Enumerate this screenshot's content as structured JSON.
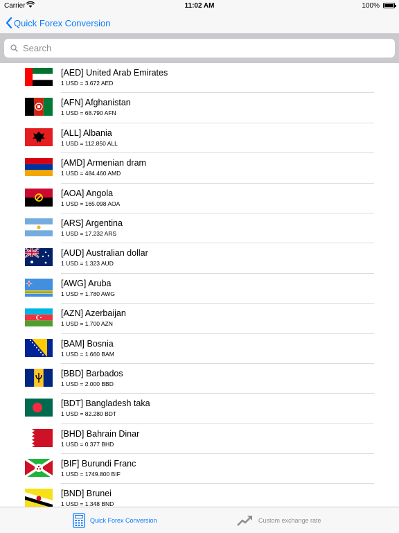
{
  "status_bar": {
    "carrier": "Carrier",
    "time": "11:02 AM",
    "battery": "100%"
  },
  "nav": {
    "back_label": "Quick Forex Conversion"
  },
  "search": {
    "placeholder": "Search"
  },
  "currencies": [
    {
      "title": "[AED] United Arab Emirates",
      "rate": "1 USD = 3.672 AED",
      "flag": "flag-uae"
    },
    {
      "title": "[AFN] Afghanistan",
      "rate": "1 USD = 68.790 AFN",
      "flag": "flag-afghanistan"
    },
    {
      "title": "[ALL] Albania",
      "rate": "1 USD = 112.850 ALL",
      "flag": "flag-albania"
    },
    {
      "title": "[AMD] Armenian dram",
      "rate": "1 USD = 484.460 AMD",
      "flag": "flag-armenia"
    },
    {
      "title": "[AOA] Angola",
      "rate": "1 USD = 165.098 AOA",
      "flag": "flag-angola"
    },
    {
      "title": "[ARS] Argentina",
      "rate": "1 USD = 17.232 ARS",
      "flag": "flag-argentina"
    },
    {
      "title": "[AUD] Australian dollar",
      "rate": "1 USD = 1.323 AUD",
      "flag": "flag-australia"
    },
    {
      "title": "[AWG] Aruba",
      "rate": "1 USD = 1.780 AWG",
      "flag": "flag-aruba"
    },
    {
      "title": "[AZN] Azerbaijan",
      "rate": "1 USD = 1.700 AZN",
      "flag": "flag-azerbaijan"
    },
    {
      "title": "[BAM] Bosnia",
      "rate": "1 USD = 1.660 BAM",
      "flag": "flag-bosnia"
    },
    {
      "title": "[BBD] Barbados",
      "rate": "1 USD = 2.000 BBD",
      "flag": "flag-barbados"
    },
    {
      "title": "[BDT] Bangladesh taka",
      "rate": "1 USD = 82.280 BDT",
      "flag": "flag-bangladesh"
    },
    {
      "title": "[BHD] Bahrain Dinar",
      "rate": "1 USD = 0.377 BHD",
      "flag": "flag-bahrain"
    },
    {
      "title": "[BIF] Burundi Franc",
      "rate": "1 USD = 1749.800 BIF",
      "flag": "flag-burundi"
    },
    {
      "title": "[BND] Brunei",
      "rate": "1 USD = 1.348 BND",
      "flag": "flag-brunei"
    }
  ],
  "tabs": [
    {
      "label": "Quick Forex Conversion",
      "icon": "calculator-icon",
      "active": true
    },
    {
      "label": "Custom exchange rate",
      "icon": "trend-arrow-icon",
      "active": false
    }
  ],
  "colors": {
    "accent": "#0a7aff",
    "inactive": "#8e8e93",
    "search_bg": "#c9c9ce"
  }
}
